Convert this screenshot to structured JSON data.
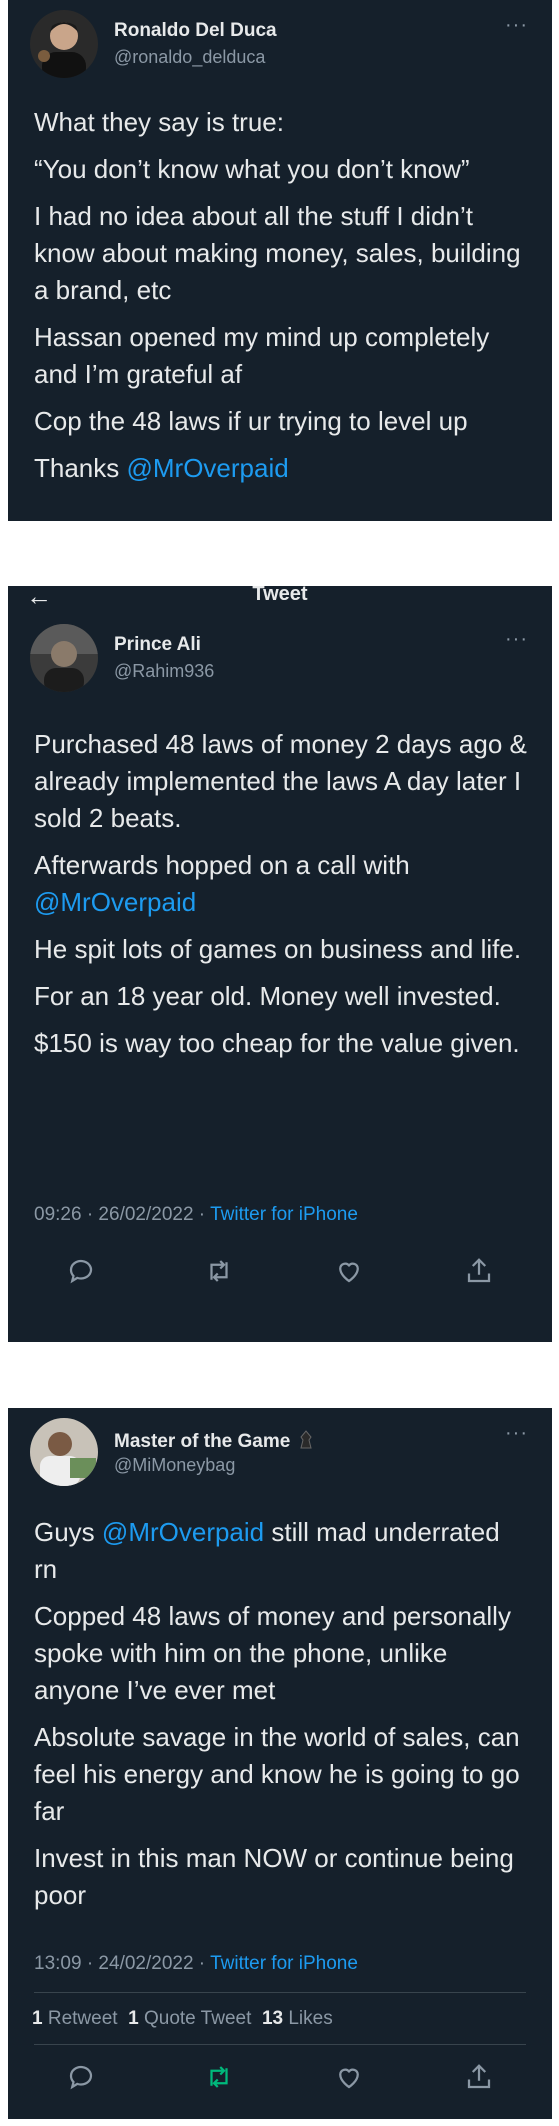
{
  "tweet1": {
    "name": "Ronaldo Del Duca",
    "handle": "@ronaldo_delduca",
    "more": "···",
    "paragraphs": {
      "p1": "What they say is true:",
      "p2": "“You don’t know what you don’t know”",
      "p3": "I had no idea about all the stuff I didn’t know about making money, sales, building a brand, etc",
      "p4": "Hassan opened my mind up completely and I’m grateful af",
      "p5": "Cop the 48 laws if ur trying to level up",
      "p6_text": "Thanks ",
      "p6_link": "@MrOverpaid"
    }
  },
  "tweet2": {
    "header_title": "Tweet",
    "back_icon": "←",
    "name": "Prince Ali",
    "handle": "@Rahim936",
    "more": "···",
    "paragraphs": {
      "p1": "Purchased 48 laws of money 2 days ago & already implemented the laws A day later I sold 2 beats.",
      "p2_text": "Afterwards hopped on a call with ",
      "p2_link": "@MrOverpaid",
      "p3": "He spit lots of games on business and life.",
      "p4": "For an 18 year old. Money well invested.",
      "p5": "$150 is way too cheap for the value given."
    },
    "time": "09:26 · 26/02/2022 · ",
    "source": "Twitter for iPhone",
    "icons": [
      "reply-icon",
      "retweet-icon",
      "like-icon",
      "share-icon"
    ]
  },
  "tweet3": {
    "name": "Master of the Game",
    "handle": "@MiMoneybag",
    "more": "···",
    "paragraphs": {
      "p1_text": "Guys ",
      "p1_link": "@MrOverpaid",
      "p1_rest": " still mad underrated rn",
      "p2": "Copped 48 laws of money and personally spoke with him on the phone, unlike anyone I’ve ever met",
      "p3": "Absolute savage in the world of sales, can feel his energy and know he is going to go far",
      "p4": "Invest in this man NOW or continue being poor"
    },
    "time": "13:09 · 24/02/2022 · ",
    "source": "Twitter for iPhone",
    "stats": {
      "retweets_count": "1",
      "retweets_label": " Retweet",
      "quotes_count": "1",
      "quotes_label": " Quote Tweet",
      "likes_count": "13",
      "likes_label": " Likes"
    },
    "icons": [
      "reply-icon",
      "retweet-icon",
      "like-icon",
      "share-icon"
    ],
    "retweet_active_color": "#00ba7c"
  },
  "colors": {
    "background": "#15202b",
    "link": "#1d9bf0",
    "muted": "#8b98a5"
  }
}
